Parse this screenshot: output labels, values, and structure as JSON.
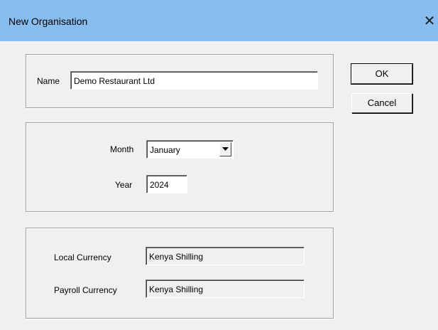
{
  "window": {
    "title": "New Organisation",
    "close_icon": "close-icon"
  },
  "name_group": {
    "label": "Name",
    "value": "Demo Restaurant Ltd"
  },
  "date_group": {
    "month_label": "Month",
    "month_value": "January",
    "year_label": "Year",
    "year_value": "2024"
  },
  "currency_group": {
    "local_label": "Local Currency",
    "local_value": "Kenya Shilling",
    "payroll_label": "Payroll Currency",
    "payroll_value": "Kenya Shilling"
  },
  "buttons": {
    "ok": "OK",
    "cancel": "Cancel"
  }
}
